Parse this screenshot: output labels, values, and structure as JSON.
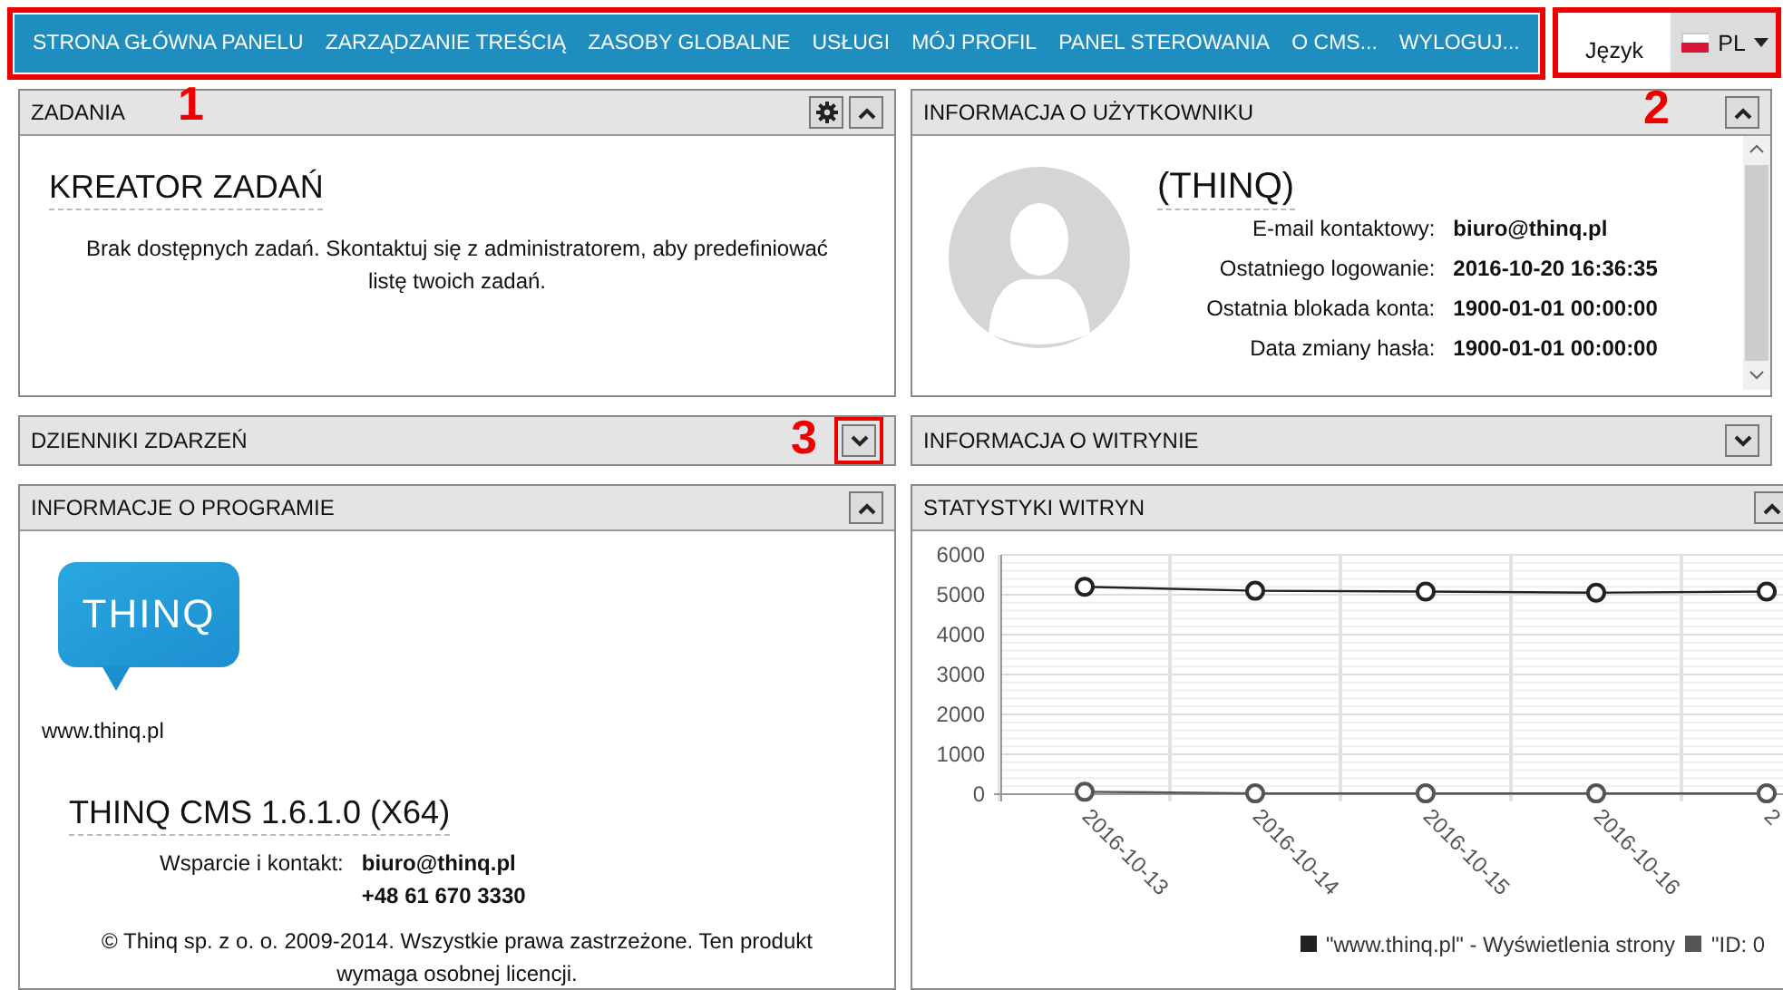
{
  "nav": {
    "items": [
      "STRONA GŁÓWNA PANELU",
      "ZARZĄDZANIE TREŚCIĄ",
      "ZASOBY GLOBALNE",
      "USŁUGI",
      "MÓJ PROFIL",
      "PANEL STEROWANIA",
      "O CMS...",
      "WYLOGUJ..."
    ]
  },
  "language": {
    "label": "Język",
    "value": "PL"
  },
  "tasks_panel": {
    "title": "ZADANIA",
    "collapsed": false,
    "heading": "KREATOR ZADAŃ",
    "message": "Brak dostępnych zadań. Skontaktuj się z administratorem, aby predefiniować listę twoich zadań."
  },
  "event_logs_panel": {
    "title": "DZIENNIKI ZDARZEŃ",
    "collapsed": true
  },
  "program_info_panel": {
    "title": "INFORMACJE O PROGRAMIE",
    "collapsed": false,
    "logo_text": "THINQ",
    "website": "www.thinq.pl",
    "product": "THINQ CMS 1.6.1.0 (X64)",
    "support_label": "Wsparcie i kontakt:",
    "support_email": "biuro@thinq.pl",
    "support_phone": "+48 61 670 3330",
    "copyright": "© Thinq sp. z o. o. 2009-2014. Wszystkie prawa zastrzeżone. Ten produkt wymaga osobnej licencji."
  },
  "user_info_panel": {
    "title": "INFORMACJA O UŻYTKOWNIKU",
    "collapsed": false,
    "name": "(THINQ)",
    "fields": [
      {
        "label": "E-mail kontaktowy:",
        "value": "biuro@thinq.pl"
      },
      {
        "label": "Ostatniego logowanie:",
        "value": "2016-10-20 16:36:35"
      },
      {
        "label": "Ostatnia blokada konta:",
        "value": "1900-01-01 00:00:00"
      },
      {
        "label": "Data zmiany hasła:",
        "value": "1900-01-01 00:00:00"
      }
    ]
  },
  "site_info_panel": {
    "title": "INFORMACJA O WITRYNIE",
    "collapsed": true
  },
  "site_stats_panel": {
    "title": "STATYSTYKI WITRYN",
    "collapsed": false,
    "chart_data": {
      "type": "line",
      "grid": true,
      "legend": true,
      "categories": [
        "2016-10-13",
        "2016-10-14",
        "2016-10-15",
        "2016-10-16",
        "2"
      ],
      "ylim": [
        0,
        6000
      ],
      "yticks": [
        0,
        1000,
        2000,
        3000,
        4000,
        5000,
        6000
      ],
      "series": [
        {
          "name": "\"www.thinq.pl\" - Wyświetlenia strony",
          "color": "#222222",
          "marker": "circle",
          "values": [
            5200,
            5100,
            5080,
            5050,
            5080
          ]
        },
        {
          "name": "\"ID: 0",
          "color": "#555555",
          "marker": "circle",
          "values": [
            60,
            20,
            20,
            20,
            20
          ]
        }
      ]
    }
  },
  "annotations": [
    {
      "label": "1"
    },
    {
      "label": "2"
    },
    {
      "label": "3"
    }
  ]
}
